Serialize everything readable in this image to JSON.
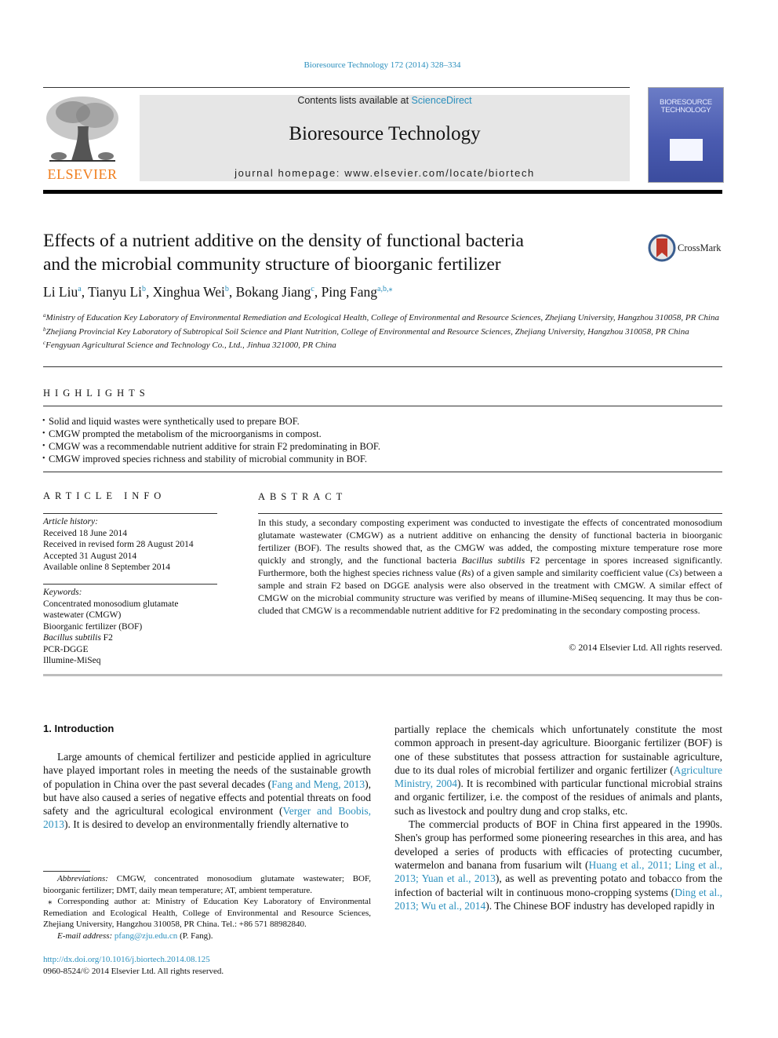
{
  "header": {
    "journal_ref": "Bioresource Technology 172 (2014) 328–334",
    "contents_prefix": "Contents lists available at ",
    "contents_link": "ScienceDirect",
    "journal_name": "Bioresource Technology",
    "homepage": "journal homepage: www.elsevier.com/locate/biortech",
    "publisher_logo_text": "ELSEVIER",
    "cover_title_line1": "BIORESOURCE",
    "cover_title_line2": "TECHNOLOGY",
    "crossmark_label": "CrossMark",
    "colors": {
      "link": "#2a8fbd",
      "elsevier_orange": "#f07e1d",
      "masthead_bg": "#e6e6e6",
      "cover_blue": "#4a5bb0"
    }
  },
  "article": {
    "title_line1": "Effects of a nutrient additive on the density of functional bacteria",
    "title_line2": "and the microbial community structure of bioorganic fertilizer",
    "authors": [
      {
        "name": "Li Liu",
        "sup": "a",
        "sep": ", "
      },
      {
        "name": "Tianyu Li",
        "sup": "b",
        "sep": ", "
      },
      {
        "name": "Xinghua Wei",
        "sup": "b",
        "sep": ", "
      },
      {
        "name": "Bokang Jiang",
        "sup": "c",
        "sep": ", "
      },
      {
        "name": "Ping Fang",
        "sup": "a,b,⁎",
        "sep": ""
      }
    ],
    "affiliations": [
      {
        "mark": "a",
        "text": "Ministry of Education Key Laboratory of Environmental Remediation and Ecological Health, College of Environmental and Resource Sciences, Zhejiang University, Hangzhou 310058, PR China"
      },
      {
        "mark": "b",
        "text": "Zhejiang Provincial Key Laboratory of Subtropical Soil Science and Plant Nutrition, College of Environmental and Resource Sciences, Zhejiang University, Hangzhou 310058, PR China"
      },
      {
        "mark": "c",
        "text": "Fengyuan Agricultural Science and Technology Co., Ltd., Jinhua 321000, PR China"
      }
    ]
  },
  "highlights": {
    "heading": "HIGHLIGHTS",
    "items": [
      "Solid and liquid wastes were synthetically used to prepare BOF.",
      "CMGW prompted the metabolism of the microorganisms in compost.",
      "CMGW was a recommendable nutrient additive for strain F2 predominating in BOF.",
      "CMGW improved species richness and stability of microbial community in BOF."
    ]
  },
  "article_info": {
    "heading": "ARTICLE INFO",
    "history_label": "Article history:",
    "history": [
      "Received 18 June 2014",
      "Received in revised form 28 August 2014",
      "Accepted 31 August 2014",
      "Available online 8 September 2014"
    ],
    "keywords_label": "Keywords:",
    "keywords": [
      "Concentrated monosodium glutamate wastewater (CMGW)",
      "Bioorganic fertilizer (BOF)",
      "Bacillus subtilis F2",
      "PCR-DGGE",
      "Illumine-MiSeq"
    ]
  },
  "abstract": {
    "heading": "ABSTRACT",
    "part1": "In this study, a secondary composting experiment was conducted to investigate the effects of concen­trated monosodium glutamate wastewater (CMGW) as a nutrient additive on enhancing the density of functional bacteria in bioorganic fertilizer (BOF). The results showed that, as the CMGW was added, the composting mixture temperature rose more quickly and strongly, and the functional bacteria ",
    "italic1": "Bacillus subtilis",
    "part2": " F2 percentage in spores increased significantly. Furthermore, both the highest species richness value (",
    "italic2": "Rs",
    "part3": ") of a given sample and similarity coefficient value (",
    "italic3": "Cs",
    "part4": ") between a sample and strain F2 based on DGGE analysis were also observed in the treatment with CMGW. A similar effect of CMGW on the microbial community structure was verified by means of illumine-MiSeq sequencing. It may thus be con­cluded that CMGW is a recommendable nutrient additive for F2 predominating in the secondary com­posting process.",
    "copyright": "© 2014 Elsevier Ltd. All rights reserved."
  },
  "introduction": {
    "heading": "1. Introduction",
    "p1_a": "Large amounts of chemical fertilizer and pesticide applied in agriculture have played important roles in meeting the needs of the sustainable growth of population in China over the past several decades (",
    "p1_ref1": "Fang and Meng, 2013",
    "p1_b": "), but have also caused a series of negative effects and potential threats on food safety and the agricultural ecological environment (",
    "p1_ref2": "Verger and Boobis, 2013",
    "p1_c": "). It is desired to develop an environmentally friendly alternative to partially replace the chemicals which unfortunately constitute the most common approach in present-day agriculture. Bioorganic fertilizer (BOF) is one of these substitutes that possess attraction for sustainable agriculture, due to its dual roles of microbial fertil­izer and organic fertilizer (",
    "p1_ref3": "Agriculture Ministry, 2004",
    "p1_d": "). It is recom­bined with particular functional microbial strains and organic fertilizer, i.e. the compost of the residues of animals and plants, such as livestock and poultry dung and crop stalks, etc.",
    "p2_a": "The commercial products of BOF in China first appeared in the 1990s. Shen's group has performed some pioneering researches in this area, and has developed a series of products with efficacies of protecting cucumber, watermelon and banana from fusarium wilt (",
    "p2_ref1": "Huang et al., 2011; Ling et al., 2013; Yuan et al., 2013",
    "p2_b": "), as well as preventing potato and tobacco from the infection of bacterial wilt in continuous mono-cropping systems (",
    "p2_ref2": "Ding et al., 2013; Wu et al., 2014",
    "p2_c": "). The Chinese BOF industry has developed rapidly in"
  },
  "footnotes": {
    "abbrev_label": "Abbreviations:",
    "abbrev_text": " CMGW, concentrated monosodium glutamate wastewater; BOF, bioorganic fertilizer; DMT, daily mean temperature; AT, ambient temperature.",
    "corresponding": "⁎ Corresponding author at: Ministry of Education Key Laboratory of Environ­mental Remediation and Ecological Health, College of Environmental and Resource Sciences, Zhejiang University, Hangzhou 310058, PR China. Tel.: +86 571 88982840.",
    "email_label": "E-mail address:",
    "email": "pfang@zju.edu.cn",
    "email_suffix": " (P. Fang).",
    "doi": "http://dx.doi.org/10.1016/j.biortech.2014.08.125",
    "issn": "0960-8524/© 2014 Elsevier Ltd. All rights reserved."
  }
}
